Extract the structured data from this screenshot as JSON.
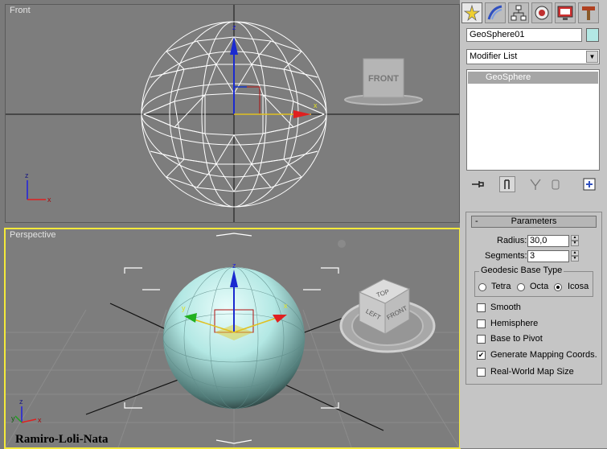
{
  "viewports": {
    "front": {
      "label": "Front",
      "viewcube_label": "FRONT"
    },
    "perspective": {
      "label": "Perspective",
      "viewcube_top": "TOP",
      "viewcube_left": "LEFT",
      "viewcube_front": "FRONT"
    },
    "axis_labels": {
      "x": "x",
      "y": "y",
      "z": "z"
    }
  },
  "watermark": "Ramiro-Loli-Nata",
  "command_panel": {
    "tabs": [
      {
        "icon": "create-icon"
      },
      {
        "icon": "modify-icon"
      },
      {
        "icon": "hierarchy-icon"
      },
      {
        "icon": "motion-icon"
      },
      {
        "icon": "display-icon"
      },
      {
        "icon": "utilities-icon"
      }
    ],
    "object_name": "GeoSphere01",
    "object_color": "#b3e8e4",
    "modifier_list": "Modifier List",
    "stack_items": [
      "GeoSphere"
    ],
    "parameters": {
      "title": "Parameters",
      "collapse_symbol": "-",
      "radius_label": "Radius:",
      "radius_value": "30,0",
      "segments_label": "Segments:",
      "segments_value": "3",
      "geodesic_title": "Geodesic Base Type",
      "tetra": "Tetra",
      "octa": "Octa",
      "icosa": "Icosa",
      "smooth": "Smooth",
      "hemisphere": "Hemisphere",
      "base_to_pivot": "Base to Pivot",
      "generate_mapping": "Generate Mapping Coords.",
      "real_world": "Real-World Map Size",
      "checkmark": "✔"
    }
  },
  "colors": {
    "active_viewport_border": "#f4e93a",
    "axis_x": "#e02020",
    "axis_y": "#20c020",
    "axis_z": "#2020e0",
    "sphere": "#b3e8e4"
  }
}
